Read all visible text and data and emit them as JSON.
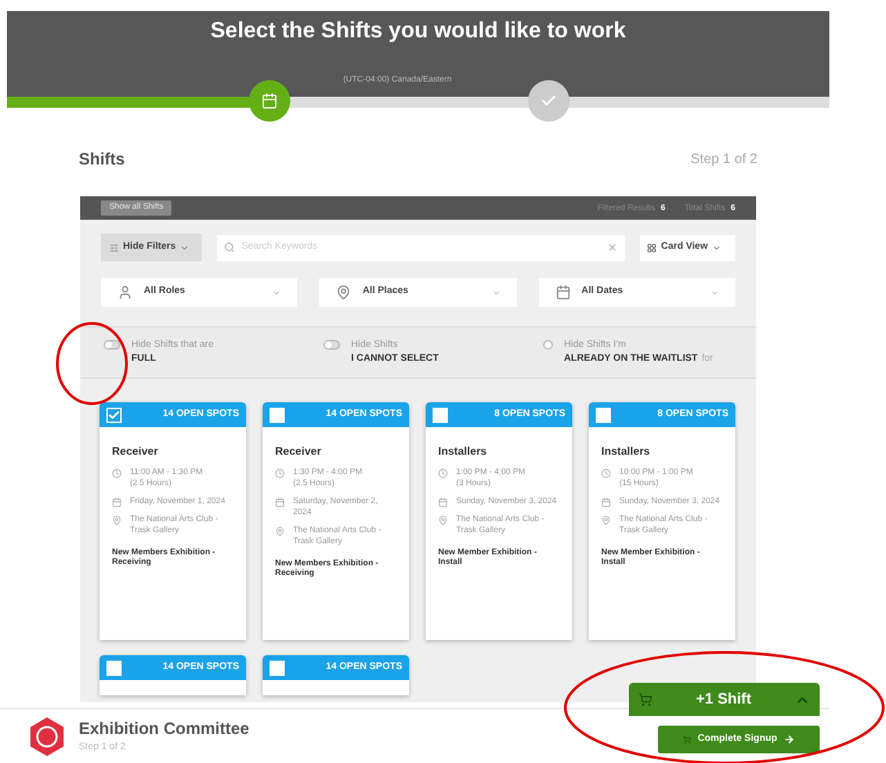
{
  "header": {
    "title": "Select the Shifts you would like to work",
    "timezone": "(UTC-04:00) Canada/Eastern",
    "steps": [
      {
        "kind": "calendar",
        "done": true
      },
      {
        "kind": "check",
        "done": false
      }
    ]
  },
  "section": {
    "title": "Shifts",
    "step": "Step 1 of 2"
  },
  "results_bar": {
    "show_all": "Show all Shifts",
    "filtered_label": "Filtered Results",
    "filtered_count": "6",
    "total_label": "Total Shifts",
    "total_count": "6"
  },
  "toolbar": {
    "filters_button": "Hide Filters",
    "search": {
      "placeholder": "Search Keywords"
    },
    "view_button": "Card View"
  },
  "filters": [
    {
      "kind": "roles",
      "label": "All Roles"
    },
    {
      "kind": "places",
      "label": "All Places"
    },
    {
      "kind": "dates",
      "label": "All Dates"
    }
  ],
  "toggles": [
    {
      "label": "Hide Shifts that are",
      "emphasis": "FULL",
      "on": false
    },
    {
      "label": "Hide Shifts",
      "emphasis": "I CANNOT SELECT",
      "on": false
    },
    {
      "label": "Hide Shifts I'm",
      "emphasis": "ALREADY ON THE WAITLIST",
      "suffix": "for",
      "on": false
    }
  ],
  "cards": [
    {
      "checked": true,
      "spots": "14 OPEN SPOTS",
      "role": "Receiver",
      "time": "11:00 AM - 1:30 PM",
      "duration": "(2.5 Hours)",
      "date": "Friday, November 1, 2024",
      "place": "The National Arts Club - Trask Gallery",
      "event": "New Members Exhibition - Receiving"
    },
    {
      "checked": false,
      "spots": "14 OPEN SPOTS",
      "role": "Receiver",
      "time": "1:30 PM - 4:00 PM",
      "duration": "(2.5 Hours)",
      "date": "Saturday, November 2, 2024",
      "place": "The National Arts Club - Trask Gallery",
      "event": "New Members Exhibition - Receiving"
    },
    {
      "checked": false,
      "spots": "8 OPEN SPOTS",
      "role": "Installers",
      "time": "1:00 PM - 4:00 PM",
      "duration": "(3 Hours)",
      "date": "Sunday, November 3, 2024",
      "place": "The National Arts Club - Trask Gallery",
      "event": "New Member Exhibition - Install"
    },
    {
      "checked": false,
      "spots": "8 OPEN SPOTS",
      "role": "Installers",
      "time": "10:00 PM - 1:00 PM",
      "duration": "(15 Hours)",
      "date": "Sunday, November 3, 2024",
      "place": "The National Arts Club - Trask Gallery",
      "event": "New Member Exhibition - Install"
    },
    {
      "checked": false,
      "spots": "14 OPEN SPOTS"
    },
    {
      "checked": false,
      "spots": "14 OPEN SPOTS"
    }
  ],
  "footer": {
    "organization": "Exhibition Committee",
    "step": "Step 1 of 2"
  },
  "cart": {
    "label": "+1 Shift",
    "expanded": false
  },
  "complete_button": "Complete Signup"
}
